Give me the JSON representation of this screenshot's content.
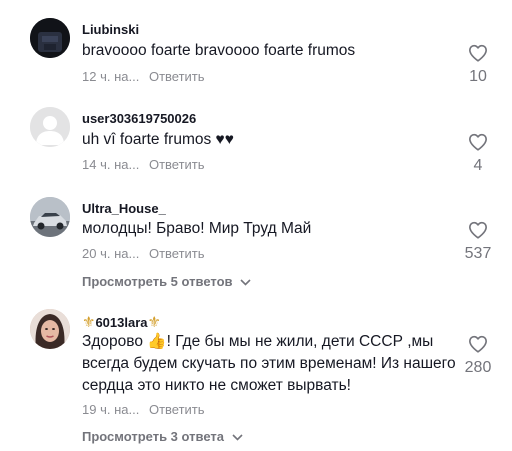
{
  "comments": [
    {
      "author": "Liubinski",
      "text": "bravoooo foarte bravoooo foarte frumos",
      "time": "12 ч. на...",
      "reply_label": "Ответить",
      "likes": "10",
      "avatar_icon": "dark-portrait-avatar"
    },
    {
      "author": "user303619750026",
      "text": "uh vî foarte frumos ♥♥",
      "time": "14 ч. на...",
      "reply_label": "Ответить",
      "likes": "4",
      "avatar_icon": "default-user-avatar"
    },
    {
      "author": "Ultra_House_",
      "text": "молодцы! Браво! Мир Труд Май",
      "time": "20 ч. на...",
      "reply_label": "Ответить",
      "likes": "537",
      "view_replies": "Просмотреть 5 ответов",
      "avatar_icon": "car-avatar"
    },
    {
      "author_prefix": "⚜",
      "author": "6013lara",
      "author_suffix": "⚜",
      "text_before_emoji": "Здорово",
      "emoji": "👍",
      "text_after_emoji": "! Где бы мы не жили, дети СССР ,мы всегда будем скучать по этим временам! Из нашего сердца это никто не сможет вырвать!",
      "time": "19 ч. на...",
      "reply_label": "Ответить",
      "likes": "280",
      "view_replies": "Просмотреть 3 ответа",
      "avatar_icon": "woman-portrait-avatar"
    }
  ],
  "colors": {
    "text": "#161823",
    "secondary": "#8a8b91",
    "like_icon": "#73747b",
    "badge": "#d39e2a"
  }
}
